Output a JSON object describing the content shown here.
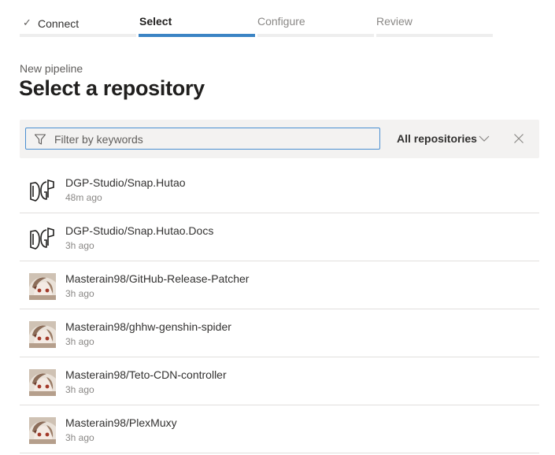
{
  "wizard": {
    "steps": [
      {
        "label": "Connect",
        "state": "done"
      },
      {
        "label": "Select",
        "state": "active"
      },
      {
        "label": "Configure",
        "state": "pending"
      },
      {
        "label": "Review",
        "state": "pending"
      }
    ],
    "check_glyph": "✓"
  },
  "page": {
    "subtitle": "New pipeline",
    "title": "Select a repository"
  },
  "filter": {
    "placeholder": "Filter by keywords",
    "value": "",
    "scope_label": "All repositories"
  },
  "colors": {
    "accent": "#3b84c4",
    "focus_border": "#4a8fd1"
  },
  "repositories": [
    {
      "name": "DGP-Studio/Snap.Hutao",
      "updated": "48m ago",
      "icon": "dgp-logo-icon"
    },
    {
      "name": "DGP-Studio/Snap.Hutao.Docs",
      "updated": "3h ago",
      "icon": "dgp-logo-icon"
    },
    {
      "name": "Masterain98/GitHub-Release-Patcher",
      "updated": "3h ago",
      "icon": "user-avatar-icon"
    },
    {
      "name": "Masterain98/ghhw-genshin-spider",
      "updated": "3h ago",
      "icon": "user-avatar-icon"
    },
    {
      "name": "Masterain98/Teto-CDN-controller",
      "updated": "3h ago",
      "icon": "user-avatar-icon"
    },
    {
      "name": "Masterain98/PlexMuxy",
      "updated": "3h ago",
      "icon": "user-avatar-icon"
    }
  ]
}
